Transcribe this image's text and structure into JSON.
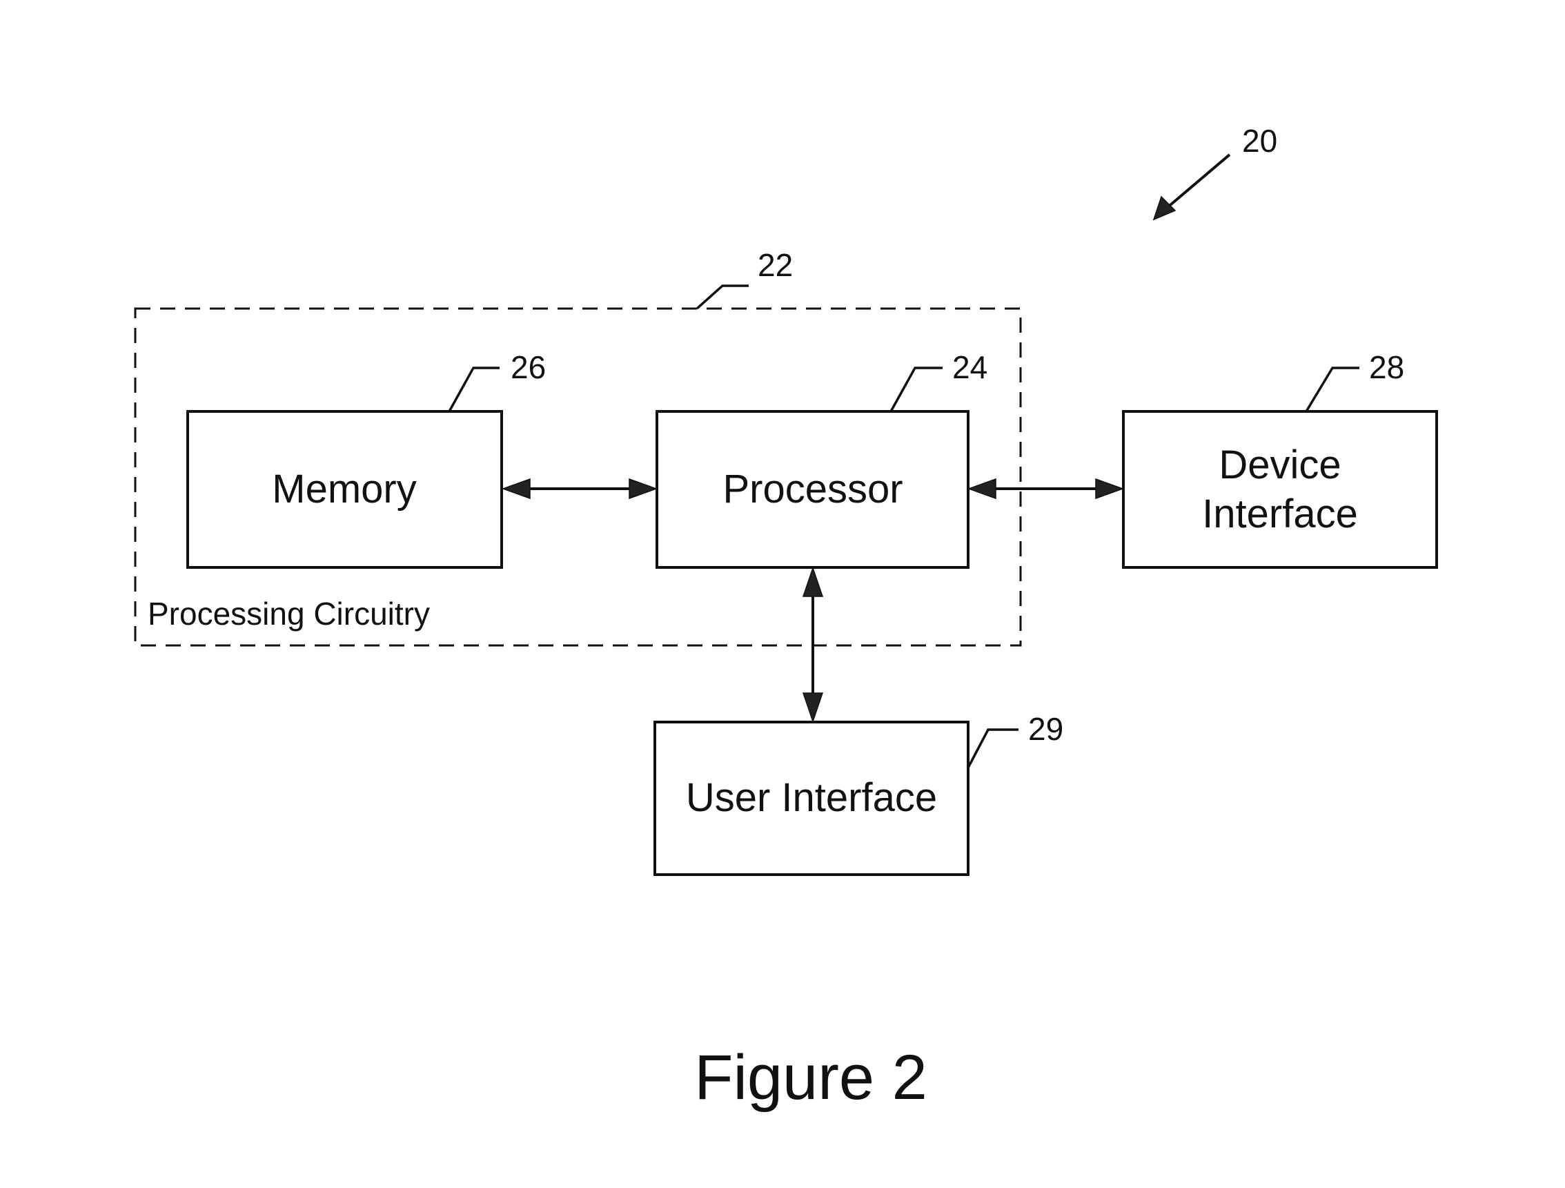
{
  "figure": {
    "caption": "Figure 2",
    "system_ref": "20"
  },
  "group": {
    "ref": "22",
    "label": "Processing Circuitry"
  },
  "blocks": {
    "memory": {
      "ref": "26",
      "lines": [
        "Memory"
      ]
    },
    "processor": {
      "ref": "24",
      "lines": [
        "Processor"
      ]
    },
    "device_interface": {
      "ref": "28",
      "lines": [
        "Device",
        "Interface"
      ]
    },
    "user_interface": {
      "ref": "29",
      "lines": [
        "User Interface"
      ]
    }
  },
  "connections": [
    {
      "from": "memory",
      "to": "processor",
      "bidirectional": true
    },
    {
      "from": "processor",
      "to": "device_interface",
      "bidirectional": true
    },
    {
      "from": "processor",
      "to": "user_interface",
      "bidirectional": true
    }
  ]
}
